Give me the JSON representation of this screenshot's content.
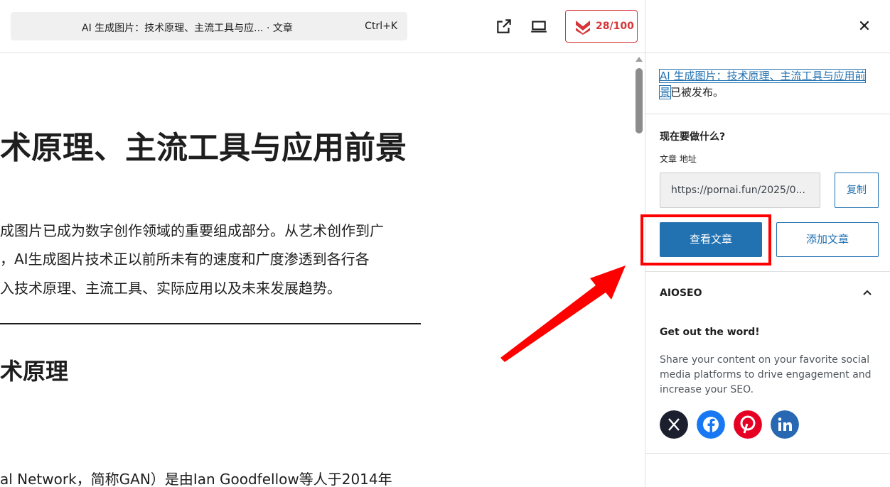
{
  "topbar": {
    "command_title": "AI 生成图片：技术原理、主流工具与应... · 文章",
    "shortcut": "Ctrl+K",
    "score": "28/100"
  },
  "content": {
    "heading1": "术原理、主流工具与应用前景",
    "para_line1": "成图片已成为数字创作领域的重要组成部分。从艺术创作到广",
    "para_line2": "，AI生成图片技术正以前所未有的速度和广度渗透到各行各",
    "para_line3": "入技术原理、主流工具、实际应用以及未来发展趋势。",
    "heading2": "术原理",
    "para2_line1": "al Network，简称GAN）是由Ian Goodfellow等人于2014年"
  },
  "panel": {
    "post_link": "AI 生成图片：技术原理、主流工具与应用前景",
    "published_suffix": "已被发布。",
    "what_next": "现在要做什么?",
    "url_label": "文章 地址",
    "url_value": "https://pornai.fun/2025/0...",
    "copy_label": "复制",
    "view_label": "查看文章",
    "add_label": "添加文章",
    "aioseo_title": "AIOSEO",
    "get_word_title": "Get out the word!",
    "share_text": "Share your content on your favorite social media platforms to drive engagement and increase your SEO."
  },
  "colors": {
    "accent": "#2271b1",
    "score_red": "#d63638",
    "highlight_red": "#ff0000",
    "x_bg": "#1b1f2e",
    "facebook": "#1877f2",
    "pinterest": "#e60023",
    "linkedin": "#2867b2"
  },
  "icons": [
    "external-link-icon",
    "laptop-preview-icon",
    "aioseo-logo-icon",
    "close-icon",
    "chevron-up-icon",
    "x-twitter-icon",
    "facebook-icon",
    "pinterest-icon",
    "linkedin-icon",
    "red-arrow-annotation"
  ]
}
